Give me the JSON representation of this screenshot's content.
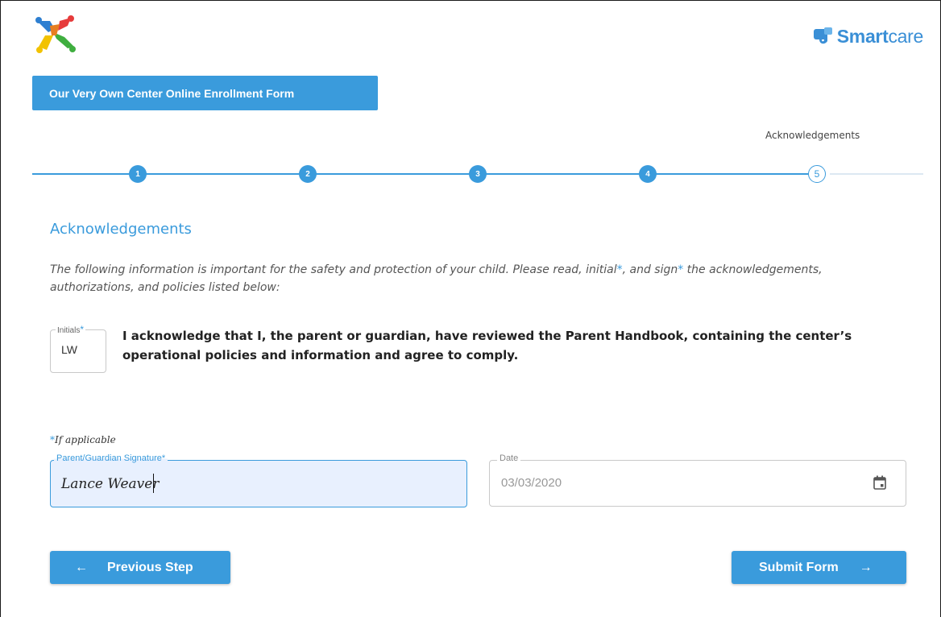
{
  "header": {
    "brand_name_bold": "Smart",
    "brand_name_light": "care",
    "form_title": "Our Very Own Center Online Enrollment Form"
  },
  "stepper": {
    "current_step_caption": "Acknowledgements",
    "steps": [
      "1",
      "2",
      "3",
      "4",
      "5"
    ],
    "current_step": 5
  },
  "section": {
    "title": "Acknowledgements",
    "intro_part1": "The following information is important for the safety and protection of your child. Please read, initial",
    "intro_req1": "*",
    "intro_part2": ", and sign",
    "intro_req2": "*",
    "intro_part3": " the acknowledgements, authorizations, and policies listed below:"
  },
  "initials": {
    "label": "Initials",
    "required_mark": "*",
    "value": "LW"
  },
  "acknowledgement": {
    "text": "I acknowledge that I, the parent or guardian, have reviewed the Parent Handbook, containing the center’s operational policies and information and agree to comply."
  },
  "note": {
    "req_mark": "*",
    "text": "If applicable"
  },
  "signature": {
    "label": "Parent/Guardian Signature",
    "required_mark": "*",
    "value": "Lance Weaver"
  },
  "date": {
    "label": "Date",
    "value": "03/03/2020"
  },
  "buttons": {
    "previous_label": "Previous Step",
    "previous_arrow": "←",
    "submit_label": "Submit Form",
    "submit_arrow": "→"
  },
  "colors": {
    "accent": "#3a9bdc",
    "field_focus_bg": "#e8f0fe"
  }
}
